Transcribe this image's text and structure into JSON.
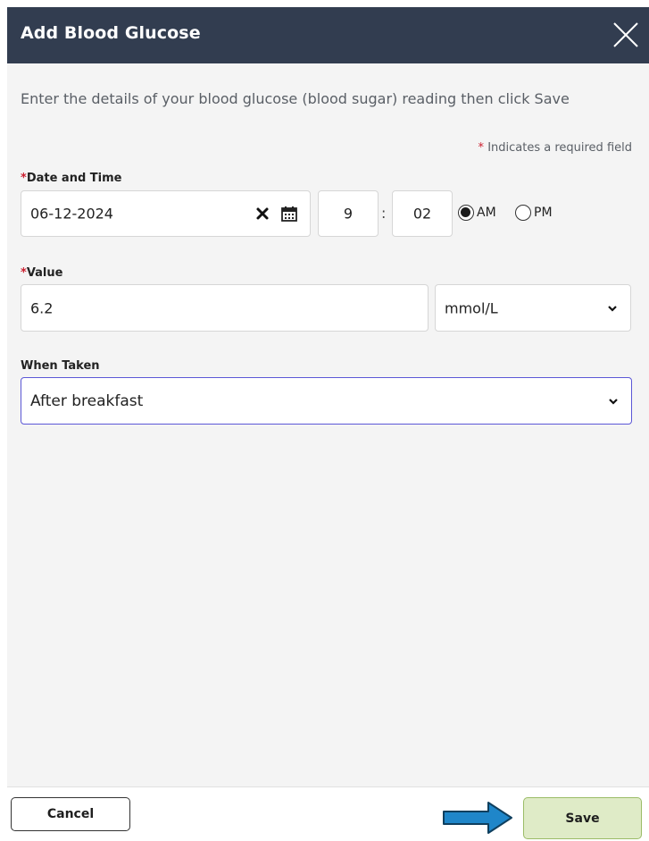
{
  "dialog": {
    "title": "Add Blood Glucose",
    "intro": "Enter the details of your blood glucose (blood sugar) reading then click Save",
    "required_star": "*",
    "required_note": "Indicates a required field"
  },
  "date_time": {
    "label": "Date and Time",
    "date_value": "06-12-2024",
    "hour": "9",
    "separator": ":",
    "minute": "02",
    "am_label": "AM",
    "pm_label": "PM",
    "selected_period": "AM"
  },
  "value": {
    "label": "Value",
    "value": "6.2",
    "unit": "mmol/L"
  },
  "when_taken": {
    "label": "When Taken",
    "value": "After breakfast"
  },
  "footer": {
    "cancel_label": "Cancel",
    "save_label": "Save"
  },
  "icons": {
    "close": "close-icon",
    "clear": "clear-icon",
    "calendar": "calendar-icon",
    "chevron": "chevron-down-icon",
    "arrow": "arrow-right-icon"
  },
  "colors": {
    "header_bg": "#323d50",
    "required": "#cc1f2f",
    "focus_border": "#5b57d6",
    "save_bg": "#dfebc7",
    "arrow": "#1f86c9"
  }
}
